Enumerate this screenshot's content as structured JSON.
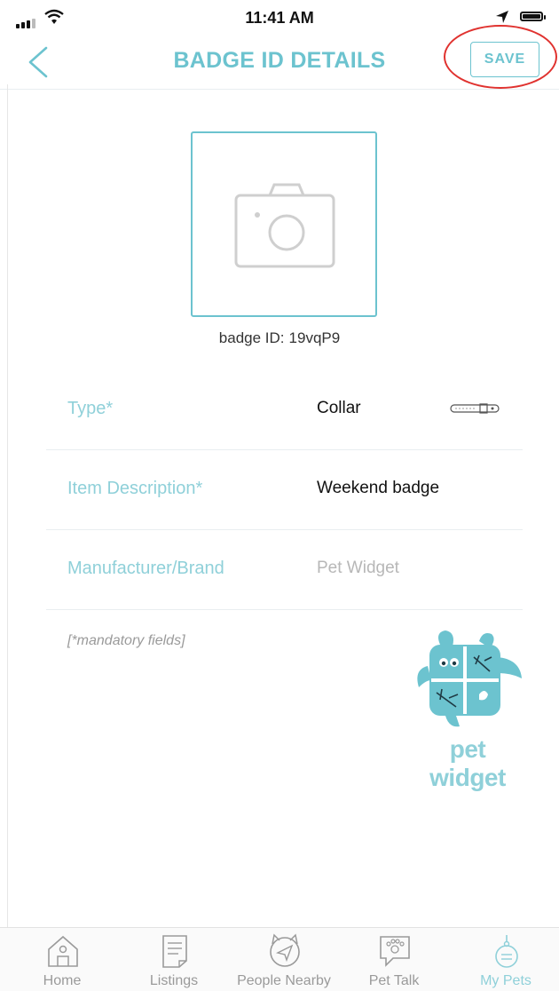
{
  "status_bar": {
    "time": "11:41 AM"
  },
  "nav": {
    "title": "BADGE ID DETAILS",
    "save_label": "SAVE"
  },
  "badge": {
    "id_label": "badge ID:",
    "id_value": "19vqP9"
  },
  "fields": [
    {
      "label": "Type*",
      "value": "Collar",
      "icon": "collar-icon"
    },
    {
      "label": "Item Description*",
      "value": "Weekend badge"
    },
    {
      "label": "Manufacturer/Brand",
      "placeholder": "Pet Widget"
    }
  ],
  "mandatory_note": "[*mandatory fields]",
  "logo": {
    "text": "pet widget"
  },
  "colors": {
    "accent": "#6cc3cf",
    "label": "#8fd0d9",
    "annotation": "#e0322f"
  },
  "tabbar": [
    {
      "label": "Home",
      "icon": "home-icon",
      "active": false
    },
    {
      "label": "Listings",
      "icon": "listings-icon",
      "active": false
    },
    {
      "label": "People Nearby",
      "icon": "people-nearby-icon",
      "active": false
    },
    {
      "label": "Pet Talk",
      "icon": "pet-talk-icon",
      "active": false
    },
    {
      "label": "My Pets",
      "icon": "my-pets-icon",
      "active": true
    }
  ]
}
